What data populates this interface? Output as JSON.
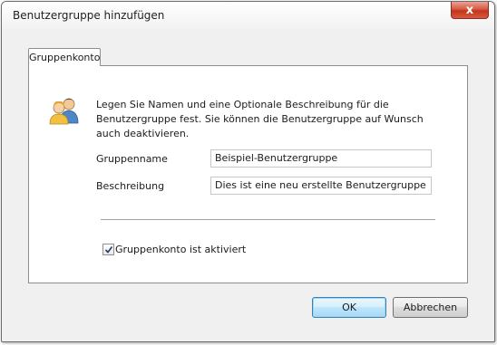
{
  "window": {
    "title": "Benutzergruppe hinzufügen",
    "close_label": "x"
  },
  "tab": {
    "label": "Gruppenkonto"
  },
  "intro": {
    "icon": "users-icon",
    "text": "Legen Sie Namen und eine Optionale Beschreibung für die Benutzergruppe fest. Sie können die Benutzergruppe auf Wunsch auch deaktivieren."
  },
  "form": {
    "group_name_label": "Gruppenname",
    "group_name_value": "Beispiel-Benutzergruppe",
    "description_label": "Beschreibung",
    "description_value": "Dies ist eine neu erstellte Benutzergruppe",
    "active_checkbox_label": "Gruppenkonto ist aktiviert",
    "active_checked": true
  },
  "buttons": {
    "ok": "OK",
    "cancel": "Abbrechen"
  },
  "colors": {
    "close_red": "#c2341c",
    "default_button_border": "#3c7fb1"
  }
}
